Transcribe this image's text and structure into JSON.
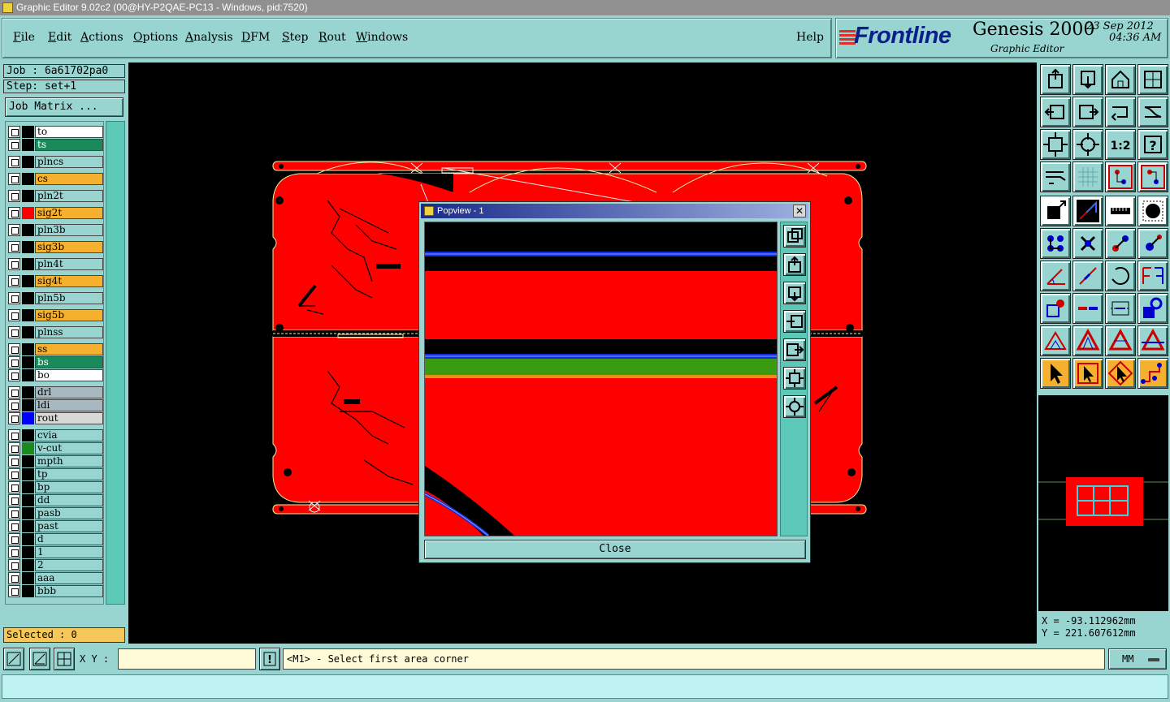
{
  "window": {
    "title": "Graphic Editor 9.02c2 (00@HY-P2QAE-PC13 - Windows, pid:7520)"
  },
  "menu": [
    {
      "label": "File",
      "key": "F",
      "rest": "ile"
    },
    {
      "label": "Edit",
      "key": "E",
      "rest": "dit"
    },
    {
      "label": "Actions",
      "key": "A",
      "rest": "ctions"
    },
    {
      "label": "Options",
      "key": "O",
      "rest": "ptions"
    },
    {
      "label": "Analysis",
      "key": "A",
      "rest": "nalysis"
    },
    {
      "label": "DFM",
      "key": "D",
      "rest": "FM"
    },
    {
      "label": "Step",
      "key": "S",
      "rest": "tep"
    },
    {
      "label": "Rout",
      "key": "R",
      "rest": "out"
    },
    {
      "label": "Windows",
      "key": "W",
      "rest": "indows"
    },
    {
      "label": "Help",
      "key": "",
      "rest": "Help"
    }
  ],
  "brand": {
    "logo": "Frontline",
    "product": "Genesis 2000",
    "subtitle": "Graphic Editor",
    "date": "23 Sep 2012",
    "time": "04:36 AM"
  },
  "job": {
    "job_line": "Job : 6a61702pa0",
    "step_line": "Step: set+1",
    "matrix_button": "Job Matrix ..."
  },
  "layers": [
    {
      "name": "to",
      "color": "#ffffff",
      "swatch": "#000000"
    },
    {
      "name": "ts",
      "color": "#1a8a5a",
      "swatch": "#000000"
    },
    {
      "name": "plncs",
      "color": "#98d4d0",
      "swatch": "#000000"
    },
    {
      "name": "cs",
      "color": "#f6b030",
      "swatch": "#000000"
    },
    {
      "name": "pln2t",
      "color": "#98d4d0",
      "swatch": "#000000"
    },
    {
      "name": "sig2t",
      "color": "#f6b030",
      "swatch": "#ff0000"
    },
    {
      "name": "pln3b",
      "color": "#98d4d0",
      "swatch": "#000000"
    },
    {
      "name": "sig3b",
      "color": "#f6b030",
      "swatch": "#000000"
    },
    {
      "name": "pln4t",
      "color": "#98d4d0",
      "swatch": "#000000"
    },
    {
      "name": "sig4t",
      "color": "#f6b030",
      "swatch": "#000000"
    },
    {
      "name": "pln5b",
      "color": "#98d4d0",
      "swatch": "#000000"
    },
    {
      "name": "sig5b",
      "color": "#f6b030",
      "swatch": "#000000"
    },
    {
      "name": "plnss",
      "color": "#98d4d0",
      "swatch": "#000000"
    },
    {
      "name": "ss",
      "color": "#f6b030",
      "swatch": "#000000"
    },
    {
      "name": "bs",
      "color": "#1a8a5a",
      "swatch": "#000000"
    },
    {
      "name": "bo",
      "color": "#ffffff",
      "swatch": "#000000"
    },
    {
      "name": "drl",
      "color": "#a8b8c0",
      "swatch": "#000000"
    },
    {
      "name": "ldi",
      "color": "#a8b8c0",
      "swatch": "#000000"
    },
    {
      "name": "rout",
      "color": "#d8d8d8",
      "swatch": "#0000ff"
    },
    {
      "name": "cvia",
      "color": "#98d4d0",
      "swatch": "#000000"
    },
    {
      "name": "v-cut",
      "color": "#98d4d0",
      "swatch": "#1a8a1a"
    },
    {
      "name": "mpth",
      "color": "#98d4d0",
      "swatch": "#000000"
    },
    {
      "name": "tp",
      "color": "#98d4d0",
      "swatch": "#000000"
    },
    {
      "name": "bp",
      "color": "#98d4d0",
      "swatch": "#000000"
    },
    {
      "name": "dd",
      "color": "#98d4d0",
      "swatch": "#000000"
    },
    {
      "name": "pasb",
      "color": "#98d4d0",
      "swatch": "#000000"
    },
    {
      "name": "past",
      "color": "#98d4d0",
      "swatch": "#000000"
    },
    {
      "name": "d",
      "color": "#98d4d0",
      "swatch": "#000000"
    },
    {
      "name": "1",
      "color": "#98d4d0",
      "swatch": "#000000"
    },
    {
      "name": "2",
      "color": "#98d4d0",
      "swatch": "#000000"
    },
    {
      "name": "aaa",
      "color": "#98d4d0",
      "swatch": "#000000"
    },
    {
      "name": "bbb",
      "color": "#98d4d0",
      "swatch": "#000000"
    }
  ],
  "selected": "Selected : 0",
  "popup": {
    "title": "Popview - 1",
    "close_x": "✕",
    "close_button": "Close"
  },
  "coords": {
    "x_line": "X = -93.112962mm",
    "y_line": "Y = 221.607612mm"
  },
  "status": {
    "xy_label": "X Y :",
    "xy_value": "",
    "alert_icon": "!",
    "prompt": "<M1> - Select first area corner",
    "units": "MM"
  },
  "tools": [
    "export-icon",
    "download-icon",
    "home-icon",
    "layout-icon",
    "move-left-icon",
    "move-right-icon",
    "swap-icon",
    "stretch-icon",
    "fit-icon",
    "center-icon",
    "ratio-icon",
    "help-icon",
    "pen-icon",
    "grid-icon",
    "snap-icon",
    "snap-active-icon",
    "select-feature-icon",
    "select-line-icon",
    "ruler-icon",
    "pad-icon",
    "net-icon",
    "cross-icon",
    "connect-icon",
    "connect2-icon",
    "angle-icon",
    "slash-icon",
    "arc-icon",
    "flip-icon",
    "pad-red-icon",
    "line-red-icon",
    "measure-icon",
    "shape-icon",
    "tri1-icon",
    "tri2-icon",
    "tri3-icon",
    "tri4-icon",
    "pointer-icon",
    "pointer-box-icon",
    "pointer-diamond-icon",
    "route-icon"
  ],
  "colors": {
    "accent": "#98d4d0",
    "board": "#ff0000",
    "highlight": "#f6b030"
  }
}
